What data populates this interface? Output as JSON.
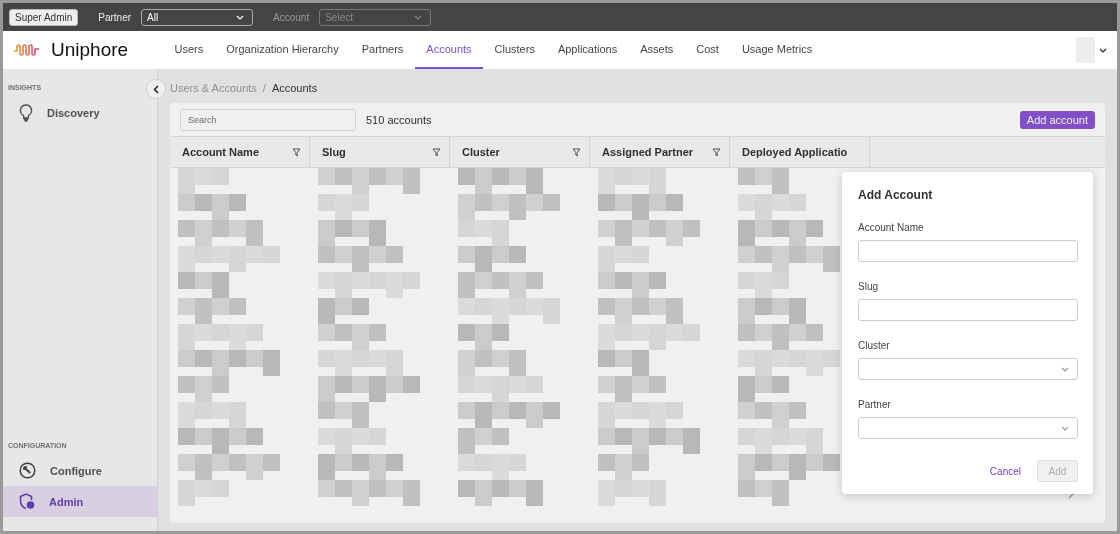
{
  "admin_bar": {
    "role_button": "Super Admin",
    "partner": {
      "label": "Partner",
      "value": "All"
    },
    "account": {
      "label": "Account",
      "placeholder": "Select",
      "disabled": true
    }
  },
  "brand": "Uniphore",
  "nav": [
    {
      "label": "Users",
      "selected": false
    },
    {
      "label": "Organization Hierarchy",
      "selected": false
    },
    {
      "label": "Partners",
      "selected": false
    },
    {
      "label": "Accounts",
      "selected": true
    },
    {
      "label": "Clusters",
      "selected": false
    },
    {
      "label": "Applications",
      "selected": false
    },
    {
      "label": "Assets",
      "selected": false
    },
    {
      "label": "Cost",
      "selected": false
    },
    {
      "label": "Usage Metrics",
      "selected": false
    }
  ],
  "sidebar": {
    "sections": [
      {
        "heading": "INSIGHTS",
        "items": [
          {
            "label": "Discovery",
            "selected": false
          }
        ]
      },
      {
        "heading": "CONFIGURATION",
        "items": [
          {
            "label": "Configure",
            "selected": false
          },
          {
            "label": "Admin",
            "selected": true
          }
        ]
      }
    ]
  },
  "breadcrumb": {
    "items": [
      "Users & Accounts",
      "Accounts"
    ],
    "separator": "/"
  },
  "search": {
    "placeholder": "Search"
  },
  "count": "510 accounts",
  "add_button": "Add account",
  "table": {
    "columns": [
      {
        "label": "Account Name",
        "filterable": true
      },
      {
        "label": "Slug",
        "filterable": true
      },
      {
        "label": "Cluster",
        "filterable": true
      },
      {
        "label": "Assigned Partner",
        "filterable": true
      },
      {
        "label": "Deployed Applicatio",
        "filterable": false
      }
    ]
  },
  "dialog": {
    "title": "Add Account",
    "fields": [
      {
        "label": "Account Name",
        "kind": "text"
      },
      {
        "label": "Slug",
        "kind": "text"
      },
      {
        "label": "Cluster",
        "kind": "select"
      },
      {
        "label": "Partner",
        "kind": "select"
      }
    ],
    "cancel": "Cancel",
    "submit": {
      "label": "Add",
      "disabled": true
    }
  }
}
